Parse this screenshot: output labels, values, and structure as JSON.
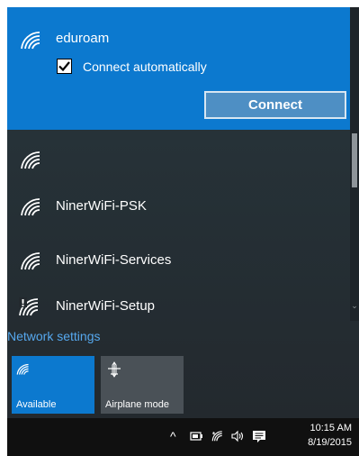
{
  "selected_network": {
    "name": "eduroam",
    "connect_auto_label": "Connect automatically",
    "connect_auto_checked": true,
    "connect_button_label": "Connect",
    "icon": "wifi-icon"
  },
  "networks": [
    {
      "name": "",
      "icon": "wifi-icon"
    },
    {
      "name": "NinerWiFi-PSK",
      "icon": "wifi-icon"
    },
    {
      "name": "NinerWiFi-Services",
      "icon": "wifi-icon"
    },
    {
      "name": "NinerWiFi-Setup",
      "icon": "wifi-warning-icon"
    }
  ],
  "network_settings_label": "Network settings",
  "quick_actions": {
    "available_label": "Available",
    "airplane_label": "Airplane mode"
  },
  "taskbar": {
    "time": "10:15 AM",
    "date": "8/19/2015"
  },
  "colors": {
    "accent": "#0c79cf",
    "flyout_bg": "#263238",
    "link": "#56a8ee"
  }
}
